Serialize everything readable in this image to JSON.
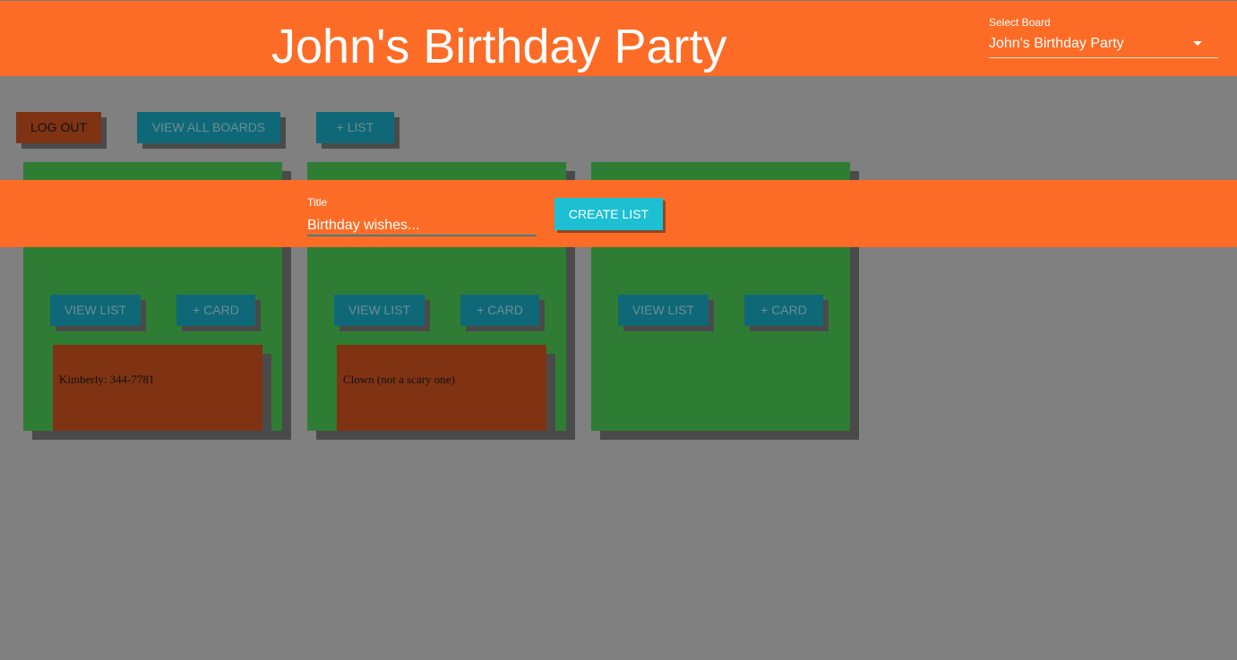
{
  "header": {
    "board_title": "John's Birthday Party",
    "select_label": "Select Board",
    "select_value": "John's Birthday Party"
  },
  "toolbar": {
    "logout_label": "LOG OUT",
    "view_all_boards_label": "VIEW ALL BOARDS",
    "add_list_label": "+ LIST"
  },
  "lists": [
    {
      "view_label": "VIEW LIST",
      "add_card_label": "+ CARD",
      "card_text": "Kimberly: 344-7781"
    },
    {
      "view_label": "VIEW LIST",
      "add_card_label": "+ CARD",
      "card_text": "Clown (not a scary one)"
    },
    {
      "view_label": "VIEW LIST",
      "add_card_label": "+ CARD"
    }
  ],
  "create_list": {
    "field_label": "Title",
    "field_value": "Birthday wishes...",
    "submit_label": "CREATE LIST"
  },
  "colors": {
    "background": "#808080",
    "header": "#fc6c26",
    "list_column": "#2f7d35",
    "card": "#7f3313",
    "teal_button": "#0f6878",
    "create_button": "#1cc0d2"
  }
}
